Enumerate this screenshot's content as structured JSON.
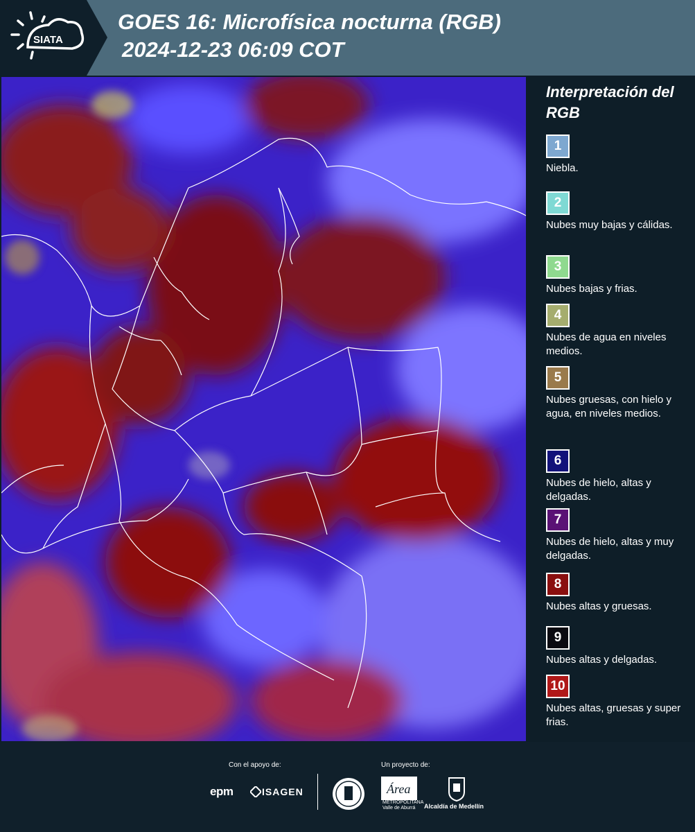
{
  "header": {
    "logo_text": "SIATA",
    "title_line1": "GOES 16: Microfísica nocturna (RGB)",
    "title_line2": "2024-12-23 06:09 COT",
    "band_color": "#4c6b7c"
  },
  "map": {
    "description_icon": "satellite-rgb-map",
    "colors": {
      "background": "#3a1fc0",
      "thick_cloud": "#8a1010",
      "thin_cloud": "#5a4bff",
      "borders": "#ffffff"
    }
  },
  "legend": {
    "title": "Interpretación del RGB",
    "items": [
      {
        "number": "1",
        "label": "Niebla.",
        "color": "#7ea8d0"
      },
      {
        "number": "2",
        "label": "Nubes muy bajas y cálidas.",
        "color": "#7fd9d4"
      },
      {
        "number": "3",
        "label": "Nubes bajas y frias.",
        "color": "#8fd98f"
      },
      {
        "number": "4",
        "label": "Nubes de agua en niveles medios.",
        "color": "#a5ad6e"
      },
      {
        "number": "5",
        "label": "Nubes gruesas, con hielo y agua, en niveles medios.",
        "color": "#9a7a4c"
      },
      {
        "number": "6",
        "label": "Nubes de hielo, altas y delgadas.",
        "color": "#12127a"
      },
      {
        "number": "7",
        "label": "Nubes de hielo, altas y muy delgadas.",
        "color": "#5a1275"
      },
      {
        "number": "8",
        "label": "Nubes altas y gruesas.",
        "color": "#8a0f0f"
      },
      {
        "number": "9",
        "label": "Nubes altas y delgadas.",
        "color": "#0a0a10"
      },
      {
        "number": "10",
        "label": "Nubes altas, gruesas y super frias.",
        "color": "#b01818"
      }
    ]
  },
  "footer": {
    "support_label": "Con el apoyo de:",
    "project_label": "Un proyecto de:",
    "sponsor1": "epm",
    "sponsor2": "ISAGEN",
    "partner_area": "Área",
    "partner_area_sub": "METROPOLITANA Valle de Aburrá",
    "partner_alcaldia": "Alcaldía de Medellín"
  }
}
